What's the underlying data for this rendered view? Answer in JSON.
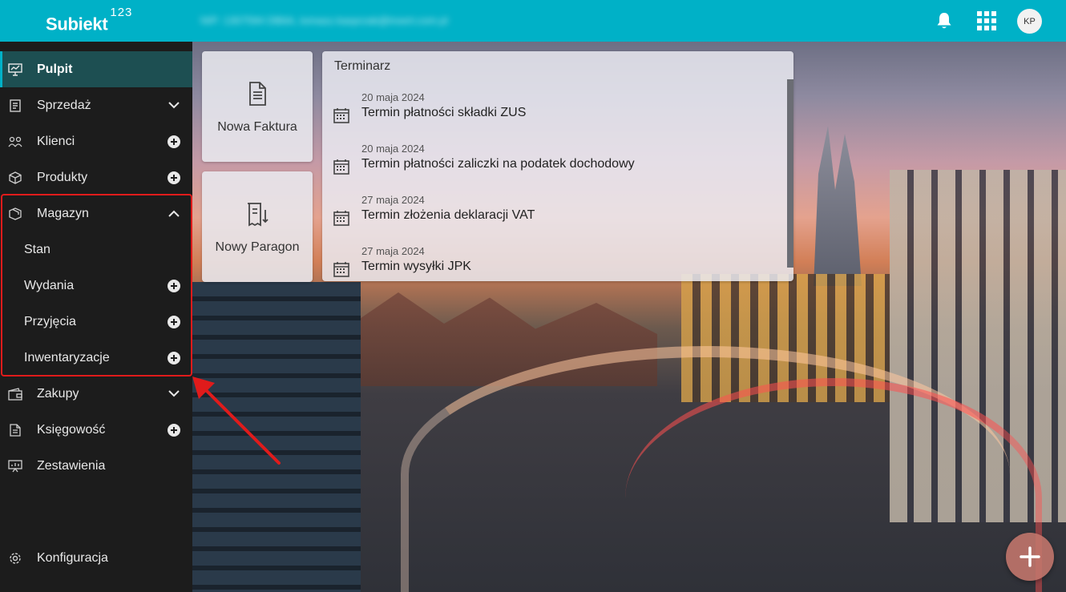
{
  "app": {
    "logo_text": "Subiekt",
    "logo_suffix": "123",
    "account_text": "NIP: 1307594 DB6A, tomasz.kasprzak@insert.com.pl",
    "avatar_initials": "KP"
  },
  "sidebar": {
    "items": [
      {
        "label": "Pulpit",
        "icon": "dashboard-icon",
        "right": "",
        "active": true
      },
      {
        "label": "Sprzedaż",
        "icon": "sales-icon",
        "right": "chevron-down"
      },
      {
        "label": "Klienci",
        "icon": "clients-icon",
        "right": "plus"
      },
      {
        "label": "Produkty",
        "icon": "products-icon",
        "right": "plus"
      },
      {
        "label": "Magazyn",
        "icon": "warehouse-icon",
        "right": "chevron-up"
      },
      {
        "label": "Stan",
        "sub": true,
        "right": ""
      },
      {
        "label": "Wydania",
        "sub": true,
        "right": "plus"
      },
      {
        "label": "Przyjęcia",
        "sub": true,
        "right": "plus"
      },
      {
        "label": "Inwentaryzacje",
        "sub": true,
        "right": "plus"
      },
      {
        "label": "Zakupy",
        "icon": "purchases-icon",
        "right": "chevron-down"
      },
      {
        "label": "Księgowość",
        "icon": "accounting-icon",
        "right": "plus"
      },
      {
        "label": "Zestawienia",
        "icon": "reports-icon",
        "right": ""
      },
      {
        "label": "Konfiguracja",
        "icon": "settings-icon",
        "right": ""
      }
    ]
  },
  "tiles": {
    "new_invoice": "Nowa Faktura",
    "new_receipt": "Nowy Paragon"
  },
  "calendar": {
    "title": "Terminarz",
    "events": [
      {
        "date": "20 maja 2024",
        "title": "Termin płatności składki ZUS"
      },
      {
        "date": "20 maja 2024",
        "title": "Termin płatności zaliczki na podatek dochodowy"
      },
      {
        "date": "27 maja 2024",
        "title": "Termin złożenia deklaracji VAT"
      },
      {
        "date": "27 maja 2024",
        "title": "Termin wysyłki JPK"
      }
    ]
  },
  "colors": {
    "topbar": "#00b1c7",
    "sidebar": "#1c1c1c",
    "active_item": "#1d4f52",
    "highlight": "#e01b1b"
  }
}
